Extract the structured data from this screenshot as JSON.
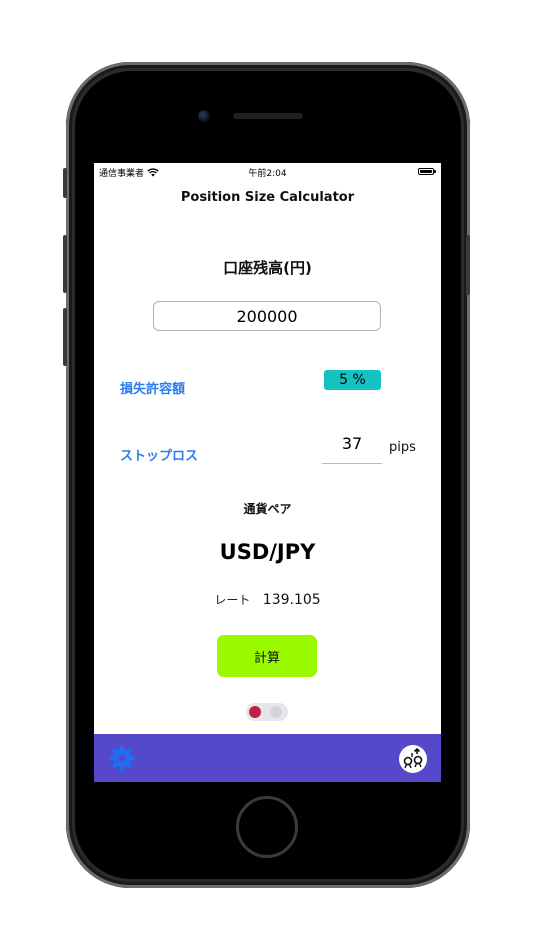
{
  "status_bar": {
    "carrier": "通信事業者",
    "time": "午前2:04"
  },
  "nav": {
    "title": "Position Size Calculator"
  },
  "account": {
    "title": "口座残高(円)",
    "balance": "200000"
  },
  "risk": {
    "label": "損失許容額",
    "value": "5 %"
  },
  "stop_loss": {
    "label": "ストップロス",
    "value": "37",
    "unit": "pips"
  },
  "currency": {
    "label": "通貨ペア",
    "pair": "USD/JPY",
    "rate_label": "レート",
    "rate": "139.105"
  },
  "actions": {
    "calculate_label": "計算"
  },
  "colors": {
    "accent_blue": "#2a7df0",
    "risk_badge": "#14c2c2",
    "calculate_button": "#9afa00",
    "tab_bar": "#5549c9",
    "toggle_knob": "#c21f47"
  },
  "tab_bar": {
    "left_icon": "gear-icon",
    "right_icon": "profile-switch-icon"
  }
}
